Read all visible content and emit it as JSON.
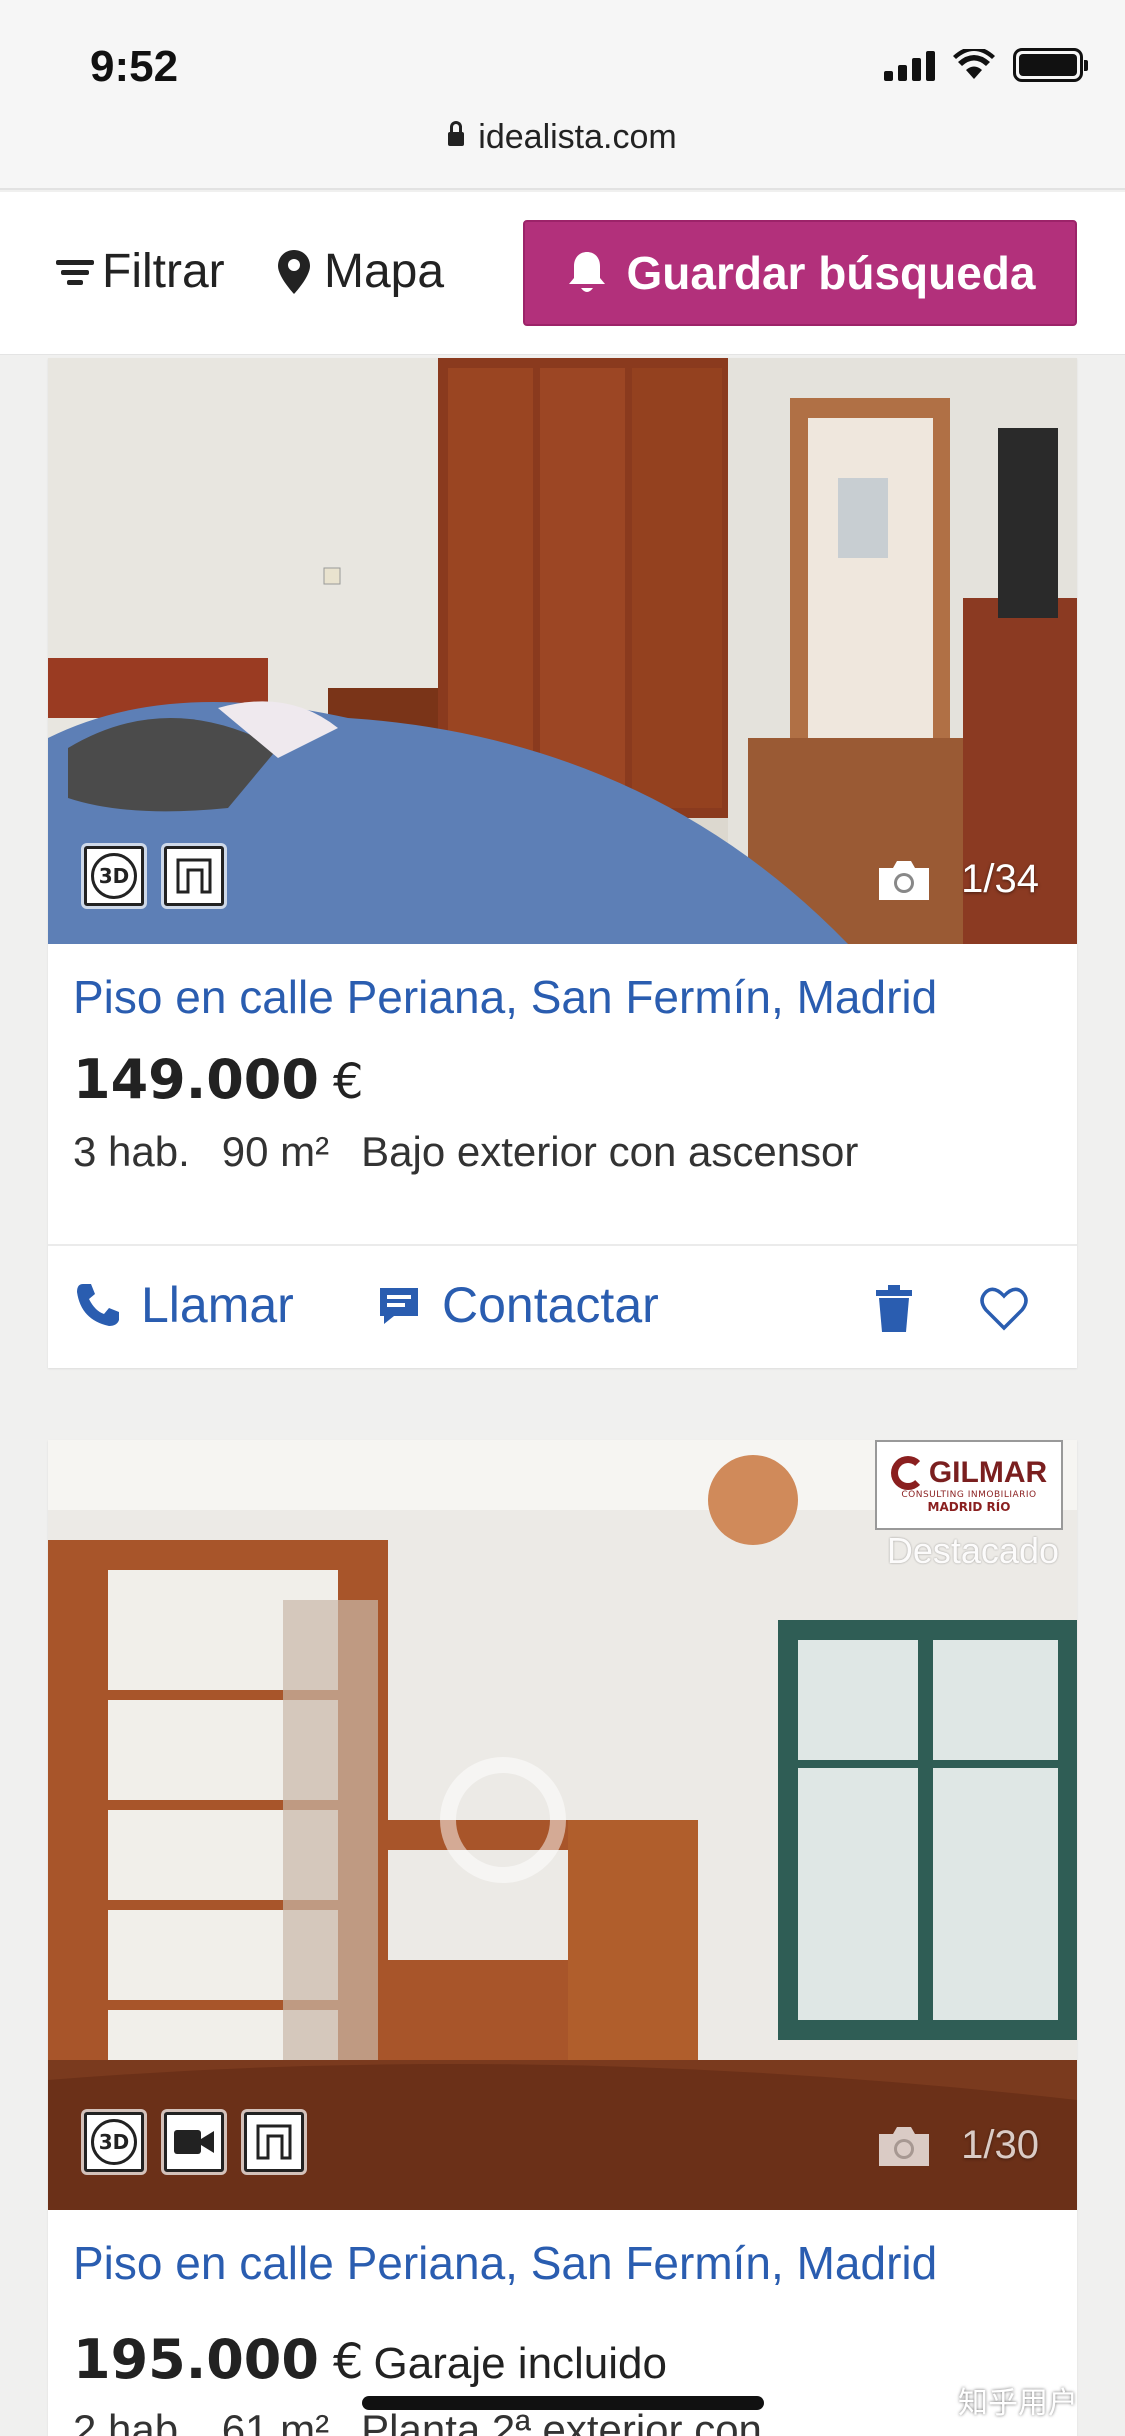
{
  "status": {
    "time": "9:52"
  },
  "browser": {
    "url": "idealista.com"
  },
  "toolbar": {
    "filter_label": "Filtrar",
    "map_label": "Mapa",
    "save_search_label": "Guardar búsqueda",
    "accent_color": "#b2307b"
  },
  "listings": [
    {
      "photo_counter": "1/34",
      "badges": [
        "3d-tour-icon",
        "floorplan-icon"
      ],
      "title": "Piso en calle Periana, San Fermín, Madrid",
      "price": "149.000",
      "currency": "€",
      "details": [
        "3 hab.",
        "90 m²",
        "Bajo exterior con ascensor"
      ],
      "actions": {
        "call": "Llamar",
        "contact": "Contactar"
      }
    },
    {
      "photo_counter": "1/30",
      "badges": [
        "3d-tour-icon",
        "video-icon",
        "floorplan-icon"
      ],
      "agency": {
        "name": "GILMAR",
        "subtitle": "CONSULTING INMOBILIARIO",
        "branch": "MADRID RÍO"
      },
      "featured_label": "Destacado",
      "title": "Piso en calle Periana, San Fermín, Madrid",
      "price": "195.000",
      "currency": "€",
      "price_extra": "Garaje incluido",
      "details": [
        "2 hab.",
        "61 m²",
        "Planta 2ª exterior con"
      ]
    }
  ],
  "watermark": "知乎用户",
  "colors": {
    "link_blue": "#2a5db0",
    "brand_magenta": "#b2307b"
  }
}
